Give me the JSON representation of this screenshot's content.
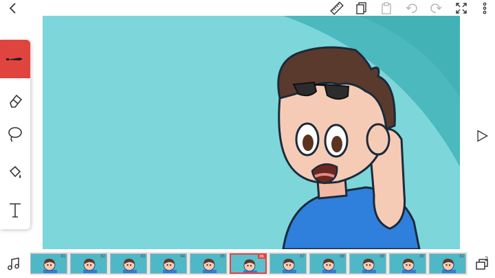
{
  "toolbar": {
    "back": "back-icon",
    "icons": [
      "ruler-icon",
      "copy-icon",
      "paste-icon",
      "undo-icon",
      "redo-icon",
      "fullscreen-icon",
      "more-icon"
    ]
  },
  "tools": [
    "pen-icon",
    "eraser-icon",
    "lasso-icon",
    "fill-bucket-icon",
    "text-icon"
  ],
  "timeline": {
    "frames": [
      "81",
      "82",
      "83",
      "84",
      "85",
      "86",
      "87",
      "88",
      "89",
      "90",
      "91"
    ],
    "selected_frame": "86",
    "layers_count": "2"
  },
  "colors": {
    "canvas_bg": "#7dd6da",
    "accent": "#e0443f",
    "shirt": "#2f7fdc",
    "hair": "#5b3a2e",
    "skin": "#f6cbb6"
  }
}
